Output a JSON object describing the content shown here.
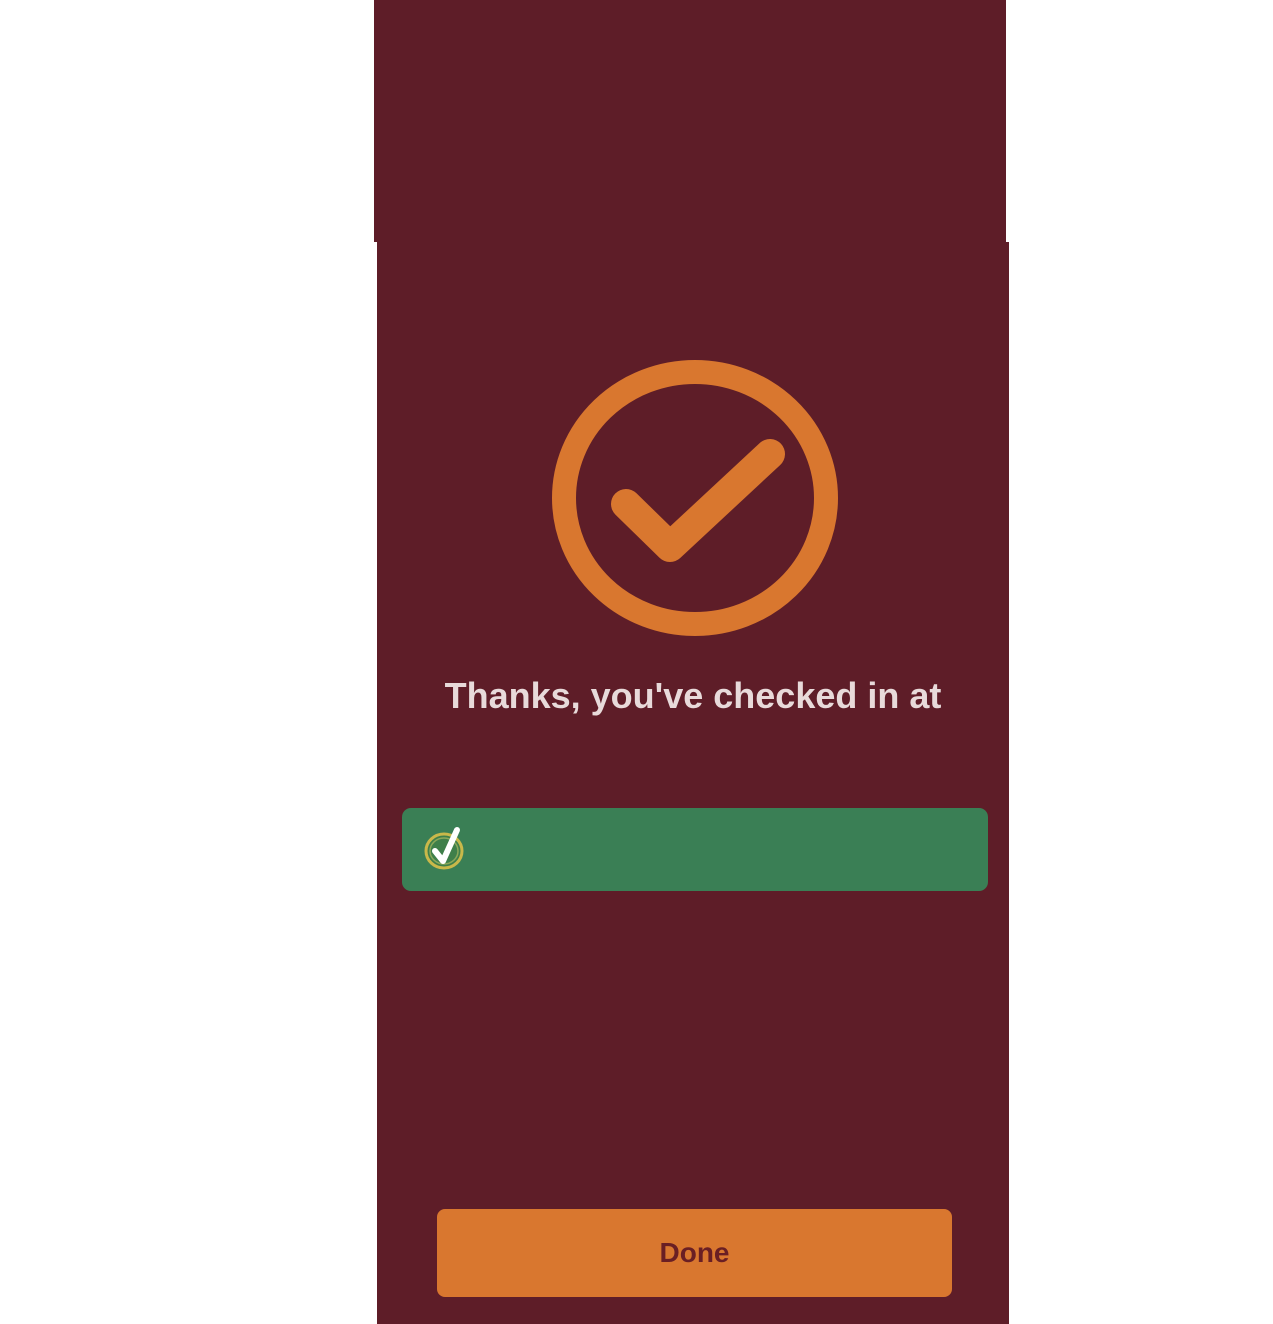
{
  "colors": {
    "background": "#ffffff",
    "panel": "#5e1d28",
    "accent_orange": "#d9772f",
    "banner_green": "#3a7f55",
    "headline_text": "#e8dada",
    "button_text": "#6a1f24"
  },
  "icons": {
    "success": "circle-checkmark-icon",
    "venue": "checkmark-badge-icon"
  },
  "confirmation": {
    "headline": "Thanks, you've checked in at"
  },
  "venue_banner": {
    "name": ""
  },
  "actions": {
    "done_label": "Done"
  }
}
